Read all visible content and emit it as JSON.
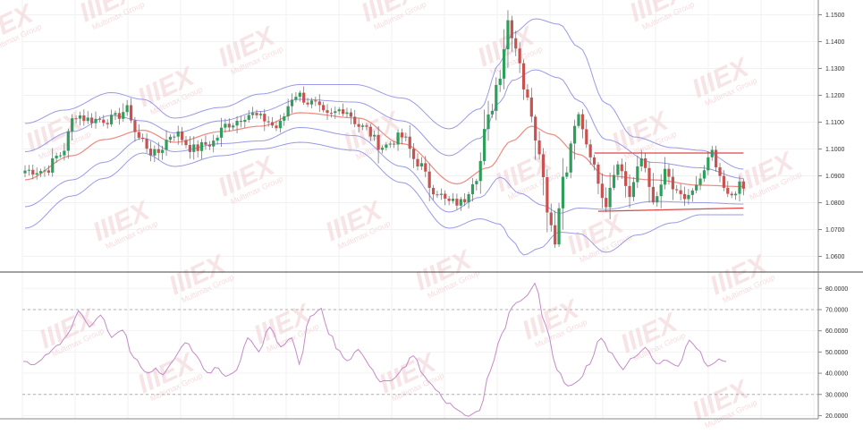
{
  "chart_data": [
    {
      "type": "candlestick",
      "title": "",
      "xlabel": "",
      "ylabel": "",
      "ylim": [
        1.0555,
        1.1535
      ],
      "yticks": [
        1.15,
        1.14,
        1.13,
        1.12,
        1.11,
        1.1,
        1.09,
        1.08,
        1.07,
        1.06
      ],
      "ytick_labels": [
        "1.1500",
        "1.1400",
        "1.1300",
        "1.1200",
        "1.1100",
        "1.1000",
        "1.0900",
        "1.0800",
        "1.0700",
        "1.0600"
      ],
      "grid": true,
      "colors": {
        "up": "#2e9e5b",
        "down": "#c9514f",
        "ma": "#f08a80",
        "bands": "#9a9ae8",
        "lines": "#e04646"
      },
      "close_anchors": [
        [
          0,
          1.092
        ],
        [
          5,
          1.092
        ],
        [
          9,
          1.098
        ],
        [
          13,
          1.113
        ],
        [
          16,
          1.111
        ],
        [
          22,
          1.111
        ],
        [
          26,
          1.1145
        ],
        [
          29,
          1.104
        ],
        [
          33,
          1.098
        ],
        [
          38,
          1.106
        ],
        [
          43,
          1.1
        ],
        [
          47,
          1.102
        ],
        [
          52,
          1.1095
        ],
        [
          57,
          1.113
        ],
        [
          61,
          1.111
        ],
        [
          64,
          1.108
        ],
        [
          69,
          1.1205
        ],
        [
          73,
          1.117
        ],
        [
          77,
          1.112
        ],
        [
          81,
          1.115
        ],
        [
          86,
          1.108
        ],
        [
          91,
          1.101
        ],
        [
          96,
          1.1045
        ],
        [
          100,
          1.095
        ],
        [
          104,
          1.085
        ],
        [
          108,
          1.08
        ],
        [
          111,
          1.08
        ],
        [
          115,
          1.09
        ],
        [
          118,
          1.1115
        ],
        [
          121,
          1.128
        ],
        [
          123,
          1.148
        ],
        [
          125,
          1.138
        ],
        [
          128,
          1.118
        ],
        [
          131,
          1.1
        ],
        [
          133,
          1.078
        ],
        [
          135,
          1.066
        ],
        [
          137,
          1.09
        ],
        [
          141,
          1.112
        ],
        [
          144,
          1.096
        ],
        [
          148,
          1.08
        ],
        [
          151,
          1.096
        ],
        [
          154,
          1.084
        ],
        [
          157,
          1.097
        ],
        [
          160,
          1.08
        ],
        [
          163,
          1.091
        ],
        [
          166,
          1.083
        ],
        [
          169,
          1.081
        ],
        [
          172,
          1.089
        ],
        [
          175,
          1.098
        ],
        [
          177,
          1.088
        ],
        [
          179,
          1.082
        ],
        [
          182,
          1.086
        ],
        [
          183,
          1.085
        ]
      ],
      "ma_anchors": [
        [
          0,
          1.0885
        ],
        [
          12,
          1.0975
        ],
        [
          20,
          1.1035
        ],
        [
          30,
          1.107
        ],
        [
          38,
          1.1025
        ],
        [
          50,
          1.1065
        ],
        [
          60,
          1.1085
        ],
        [
          70,
          1.1135
        ],
        [
          85,
          1.1115
        ],
        [
          96,
          1.102
        ],
        [
          110,
          1.087
        ],
        [
          118,
          1.093
        ],
        [
          124,
          1.103
        ],
        [
          129,
          1.1085
        ],
        [
          134,
          1.1055
        ],
        [
          141,
          1.098
        ],
        [
          148,
          1.09
        ],
        [
          160,
          1.0885
        ],
        [
          172,
          1.0865
        ],
        [
          183,
          1.086
        ]
      ],
      "upper_band_anchors": [
        [
          0,
          1.1095
        ],
        [
          10,
          1.1145
        ],
        [
          22,
          1.121
        ],
        [
          30,
          1.1185
        ],
        [
          38,
          1.1115
        ],
        [
          50,
          1.1155
        ],
        [
          60,
          1.1205
        ],
        [
          70,
          1.124
        ],
        [
          84,
          1.124
        ],
        [
          96,
          1.119
        ],
        [
          108,
          1.1075
        ],
        [
          116,
          1.115
        ],
        [
          121,
          1.132
        ],
        [
          124,
          1.143
        ],
        [
          130,
          1.1485
        ],
        [
          136,
          1.1465
        ],
        [
          141,
          1.138
        ],
        [
          148,
          1.117
        ],
        [
          155,
          1.1045
        ],
        [
          165,
          1.1005
        ],
        [
          172,
          1.0995
        ],
        [
          183,
          1.0925
        ]
      ],
      "mid_upper_band_anchors": [
        [
          0,
          1.099
        ],
        [
          12,
          1.1065
        ],
        [
          22,
          1.1125
        ],
        [
          30,
          1.1105
        ],
        [
          38,
          1.106
        ],
        [
          50,
          1.1105
        ],
        [
          60,
          1.114
        ],
        [
          70,
          1.1185
        ],
        [
          84,
          1.1175
        ],
        [
          96,
          1.1105
        ],
        [
          108,
          1.0975
        ],
        [
          116,
          1.104
        ],
        [
          121,
          1.1175
        ],
        [
          124,
          1.1255
        ],
        [
          130,
          1.1295
        ],
        [
          136,
          1.1265
        ],
        [
          141,
          1.118
        ],
        [
          148,
          1.1035
        ],
        [
          160,
          1.095
        ],
        [
          172,
          1.093
        ],
        [
          183,
          1.089
        ]
      ],
      "mid_lower_band_anchors": [
        [
          0,
          1.0785
        ],
        [
          12,
          1.0885
        ],
        [
          20,
          1.095
        ],
        [
          30,
          1.104
        ],
        [
          38,
          1.099
        ],
        [
          50,
          1.102
        ],
        [
          60,
          1.103
        ],
        [
          70,
          1.108
        ],
        [
          84,
          1.105
        ],
        [
          96,
          1.0935
        ],
        [
          108,
          1.0765
        ],
        [
          116,
          1.082
        ],
        [
          121,
          1.0895
        ],
        [
          126,
          1.0835
        ],
        [
          132,
          1.079
        ],
        [
          136,
          1.076
        ],
        [
          141,
          1.078
        ],
        [
          148,
          1.0775
        ],
        [
          160,
          1.0805
        ],
        [
          172,
          1.08
        ],
        [
          183,
          1.0795
        ]
      ],
      "lower_band_anchors": [
        [
          0,
          1.0705
        ],
        [
          12,
          1.0825
        ],
        [
          20,
          1.089
        ],
        [
          30,
          1.0985
        ],
        [
          38,
          1.0935
        ],
        [
          50,
          1.0975
        ],
        [
          60,
          1.1
        ],
        [
          70,
          1.1025
        ],
        [
          84,
          1.0995
        ],
        [
          96,
          1.0875
        ],
        [
          108,
          1.0705
        ],
        [
          116,
          1.074
        ],
        [
          121,
          1.072
        ],
        [
          124,
          1.066
        ],
        [
          127,
          1.0605
        ],
        [
          131,
          1.063
        ],
        [
          136,
          1.069
        ],
        [
          141,
          1.0685
        ],
        [
          148,
          1.0615
        ],
        [
          156,
          1.068
        ],
        [
          165,
          1.0725
        ],
        [
          172,
          1.0755
        ],
        [
          183,
          1.0755
        ]
      ],
      "horizontal_lines": [
        {
          "x1": 145,
          "x2": 183,
          "y1": 1.0985,
          "y2": 1.0985
        },
        {
          "x1": 146,
          "x2": 183,
          "y1": 1.0768,
          "y2": 1.078
        }
      ]
    },
    {
      "type": "line",
      "title": "",
      "xlabel": "",
      "ylabel": "",
      "ylim": [
        18.5,
        83.5
      ],
      "yticks": [
        80,
        70,
        60,
        50,
        40,
        30,
        20
      ],
      "ytick_labels": [
        "80.0000",
        "70.0000",
        "60.0000",
        "50.0000",
        "40.0000",
        "30.0000",
        "20.0000"
      ],
      "reference_lines": [
        70,
        30
      ],
      "color": "#c58ac8",
      "anchors": [
        [
          0,
          45
        ],
        [
          3,
          44
        ],
        [
          6,
          48
        ],
        [
          9,
          53
        ],
        [
          12,
          58
        ],
        [
          15,
          69
        ],
        [
          18,
          62
        ],
        [
          21,
          67
        ],
        [
          24,
          57
        ],
        [
          27,
          60
        ],
        [
          30,
          48
        ],
        [
          33,
          40
        ],
        [
          36,
          42
        ],
        [
          38,
          39
        ],
        [
          41,
          47
        ],
        [
          44,
          55
        ],
        [
          47,
          48
        ],
        [
          50,
          40
        ],
        [
          53,
          43
        ],
        [
          55,
          38
        ],
        [
          58,
          42
        ],
        [
          61,
          57
        ],
        [
          64,
          50
        ],
        [
          67,
          62
        ],
        [
          70,
          53
        ],
        [
          73,
          57
        ],
        [
          75,
          45
        ],
        [
          78,
          67
        ],
        [
          81,
          70
        ],
        [
          83,
          59
        ],
        [
          86,
          50
        ],
        [
          88,
          46
        ],
        [
          91,
          51
        ],
        [
          94,
          44
        ],
        [
          97,
          36
        ],
        [
          100,
          36
        ],
        [
          103,
          42
        ],
        [
          106,
          48
        ],
        [
          109,
          38
        ],
        [
          112,
          33
        ],
        [
          115,
          26
        ],
        [
          118,
          23
        ],
        [
          121,
          20
        ],
        [
          124,
          22
        ],
        [
          127,
          42
        ],
        [
          130,
          58
        ],
        [
          133,
          72
        ],
        [
          136,
          75
        ],
        [
          139,
          82
        ],
        [
          142,
          62
        ],
        [
          145,
          42
        ],
        [
          148,
          34
        ],
        [
          151,
          36
        ],
        [
          154,
          45
        ],
        [
          157,
          57
        ],
        [
          160,
          49
        ],
        [
          163,
          42
        ],
        [
          166,
          48
        ],
        [
          169,
          52
        ],
        [
          172,
          45
        ],
        [
          175,
          46
        ],
        [
          178,
          43
        ],
        [
          181,
          56
        ],
        [
          183,
          52
        ],
        [
          186,
          44
        ],
        [
          189,
          46
        ],
        [
          191,
          46
        ]
      ]
    }
  ],
  "watermark": {
    "brand": "IIIEX",
    "sub": "Multimax Group"
  }
}
